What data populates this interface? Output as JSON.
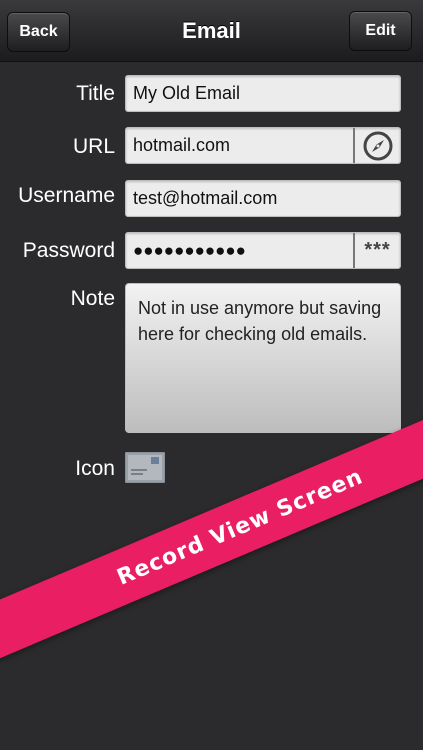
{
  "navbar": {
    "back_label": "Back",
    "title": "Email",
    "edit_label": "Edit"
  },
  "fields": {
    "title_label": "Title",
    "title_value": "My Old Email",
    "url_label": "URL",
    "url_value": "hotmail.com",
    "username_label": "Username",
    "username_value": "test@hotmail.com",
    "password_label": "Password",
    "password_value": "●●●●●●●●●●●",
    "password_toggle": "***",
    "note_label": "Note",
    "note_value": "Not in use anymore but saving here for checking old emails.",
    "icon_label": "Icon"
  },
  "banner": {
    "text": "Record View Screen",
    "color": "#e91e63"
  },
  "icons": {
    "url_action": "compass-icon",
    "record_icon": "envelope-icon"
  }
}
